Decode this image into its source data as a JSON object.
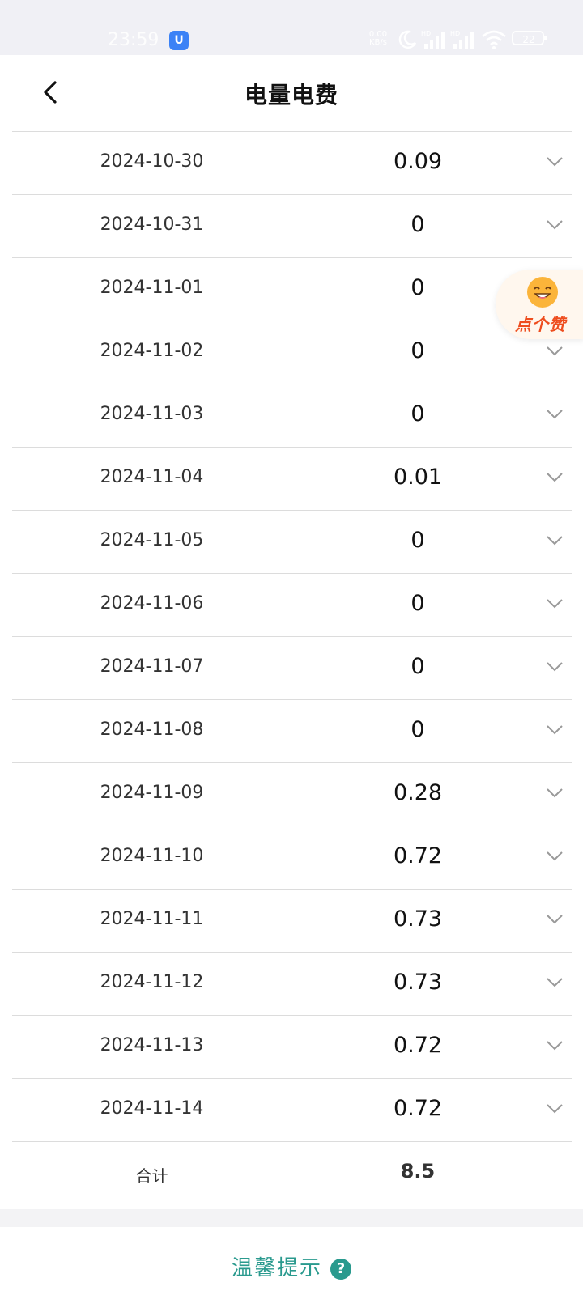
{
  "status_bar": {
    "time": "23:59",
    "app_badge": "U",
    "net_speed_value": "0.00",
    "net_speed_unit": "KB/s",
    "battery": "22",
    "icons": [
      "moon-icon",
      "hd-signal-icon",
      "hd-signal-icon",
      "wifi-icon",
      "battery-icon"
    ]
  },
  "header": {
    "title": "电量电费",
    "back_icon": "chevron-left-icon"
  },
  "rows": [
    {
      "date": "2024-10-30",
      "value": "0.09"
    },
    {
      "date": "2024-10-31",
      "value": "0"
    },
    {
      "date": "2024-11-01",
      "value": "0"
    },
    {
      "date": "2024-11-02",
      "value": "0"
    },
    {
      "date": "2024-11-03",
      "value": "0"
    },
    {
      "date": "2024-11-04",
      "value": "0.01"
    },
    {
      "date": "2024-11-05",
      "value": "0"
    },
    {
      "date": "2024-11-06",
      "value": "0"
    },
    {
      "date": "2024-11-07",
      "value": "0"
    },
    {
      "date": "2024-11-08",
      "value": "0"
    },
    {
      "date": "2024-11-09",
      "value": "0.28"
    },
    {
      "date": "2024-11-10",
      "value": "0.72"
    },
    {
      "date": "2024-11-11",
      "value": "0.73"
    },
    {
      "date": "2024-11-12",
      "value": "0.73"
    },
    {
      "date": "2024-11-13",
      "value": "0.72"
    },
    {
      "date": "2024-11-14",
      "value": "0.72"
    }
  ],
  "total": {
    "label": "合计",
    "value": "8.5"
  },
  "like_badge": {
    "label": "点个赞",
    "icon": "smiley-emoji-icon"
  },
  "tips": {
    "label": "温馨提示",
    "icon": "question-circle-icon",
    "icon_glyph": "?"
  },
  "colors": {
    "accent": "#2a9a8e",
    "like_text": "#ee4d1e",
    "status_bg": "#f0f0f5"
  }
}
